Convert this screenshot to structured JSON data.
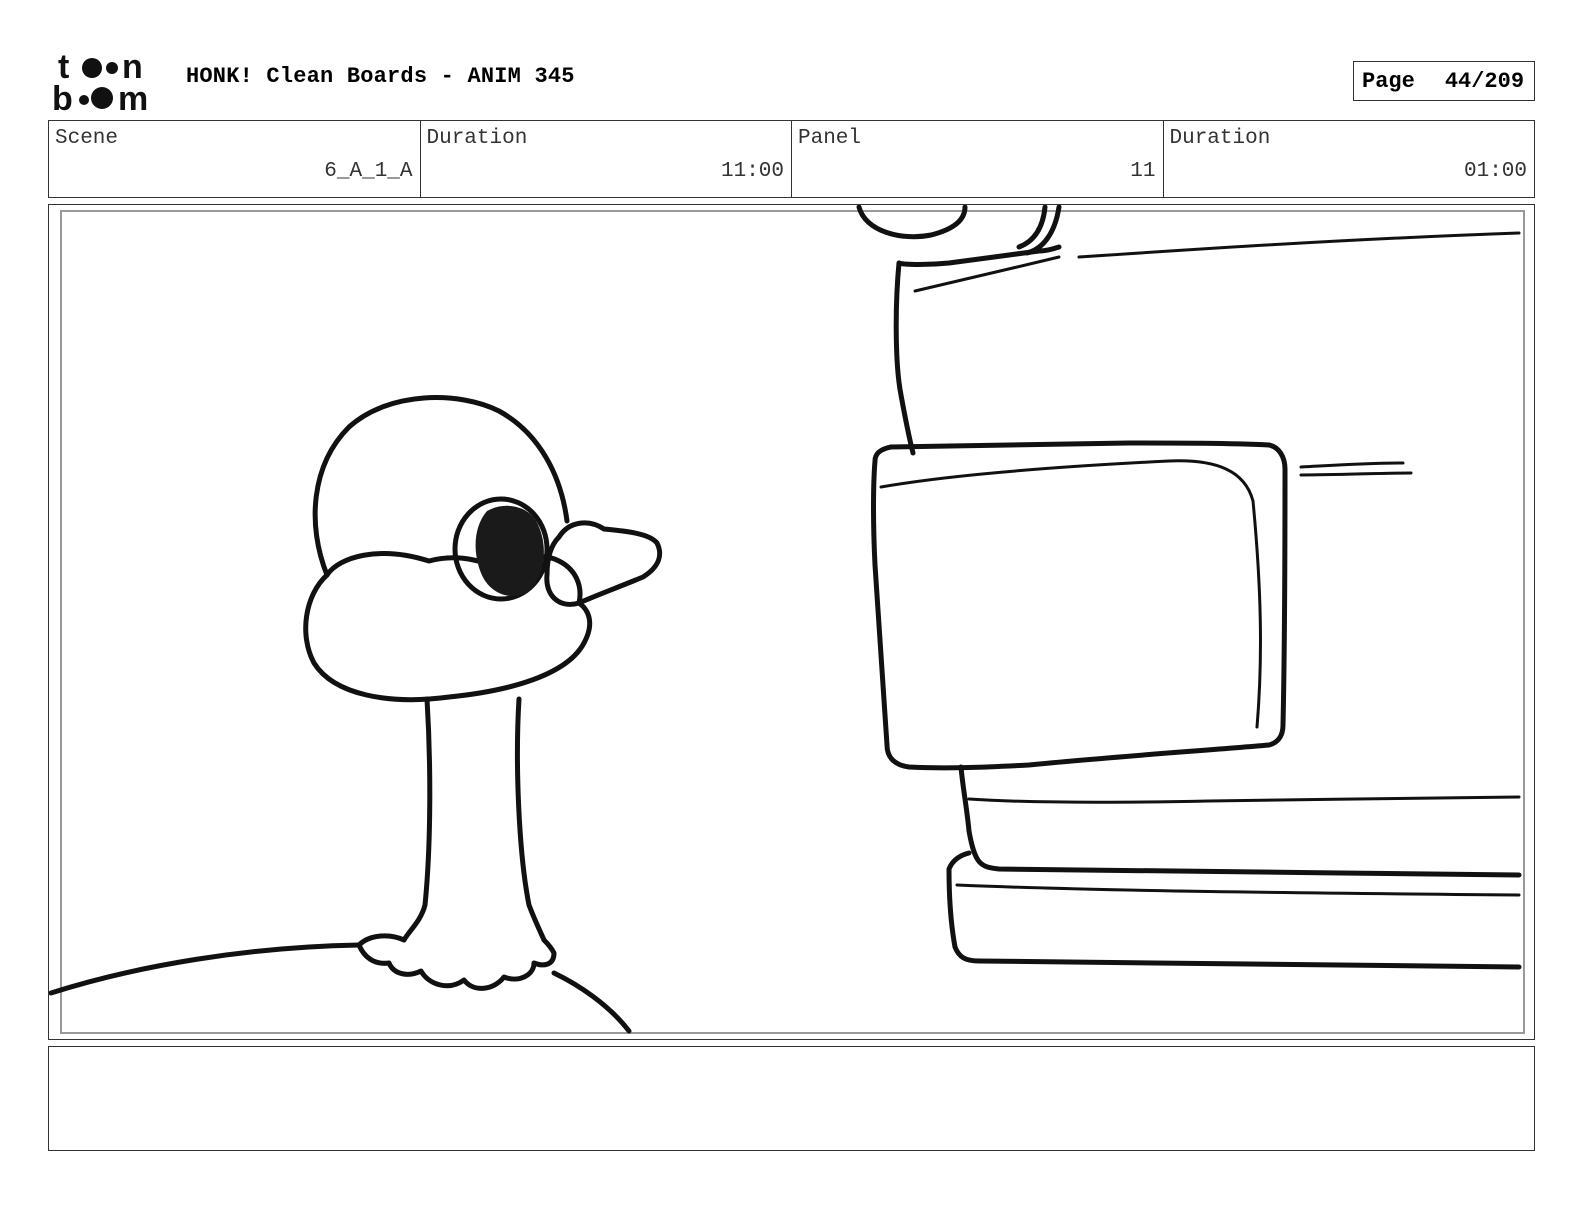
{
  "header": {
    "logo_text": "toon boom",
    "title": "HONK! Clean Boards - ANIM 345",
    "page_label": "Page",
    "page_number": "44/209"
  },
  "info": {
    "scene_label": "Scene",
    "scene_value": "6_A_1_A",
    "scene_duration_label": "Duration",
    "scene_duration_value": "11:00",
    "panel_label": "Panel",
    "panel_value": "11",
    "panel_duration_label": "Duration",
    "panel_duration_value": "01:00"
  },
  "notes": {
    "text": ""
  }
}
